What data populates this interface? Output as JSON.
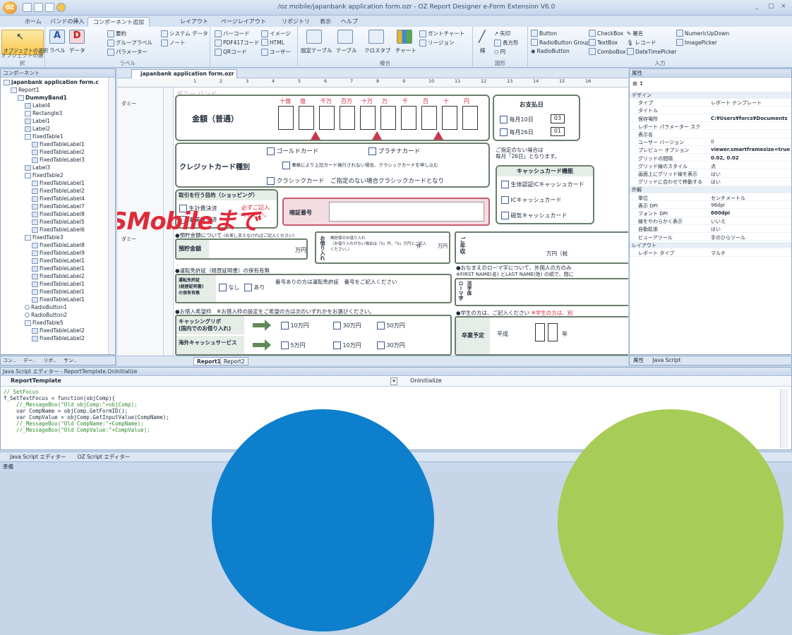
{
  "window": {
    "title": "/oz mobile/japanbank application form.ozr - OZ Report Designer e-Form Extension V6.0",
    "app_logo": "OZ",
    "controls": [
      "_",
      "□",
      "×"
    ]
  },
  "ribbon": {
    "tabs": [
      "ホーム",
      "バンドの挿入",
      "コンポーネント追加",
      "レイアウト",
      "ページレイアウト",
      "リポジトリ",
      "表示",
      "ヘルプ"
    ],
    "active_tab": "コンポーネント追加",
    "groups": {
      "object": {
        "select": "オブジェクトの選択",
        "group_label": "オブジェクトの選択"
      },
      "label": {
        "items": [
          "ラベル",
          "データ",
          "要約",
          "グループラベル",
          "パラメーター",
          "システム データ",
          "ノート",
          "バーコード",
          "PDF417コード",
          "QRコード",
          "イメージ",
          "HTML",
          "ユーザー"
        ],
        "group_label": "ラベル"
      },
      "composite": {
        "items": [
          "固定テーブル",
          "テーブル",
          "クロスタブ",
          "チャート",
          "ガントチャート",
          "リージョン"
        ],
        "group_label": "複合"
      },
      "shapes": {
        "items": [
          "線",
          "矢印",
          "長方形",
          "円"
        ],
        "group_label": "図形"
      },
      "input": {
        "items": [
          "Button",
          "RadioButton Group",
          "RadioButton",
          "CheckBox",
          "TextBox",
          "ComboBox",
          "署名",
          "レコード",
          "DateTimePicker",
          "NumericUpDown",
          "ImagePicker"
        ],
        "group_label": "入力"
      }
    }
  },
  "left_panel": {
    "title": "コンポーネント",
    "tree": [
      {
        "label": "japanbank application form.c",
        "level": 0,
        "bold": true
      },
      {
        "label": "Report1",
        "level": 1
      },
      {
        "label": "DummyBand1",
        "level": 2,
        "bold": true
      },
      {
        "label": "Label4",
        "level": 3
      },
      {
        "label": "Rectangle3",
        "level": 3
      },
      {
        "label": "Label1",
        "level": 3
      },
      {
        "label": "Label2",
        "level": 3
      },
      {
        "label": "FixedTable1",
        "level": 3
      },
      {
        "label": "FixedTableLabel1",
        "level": 4
      },
      {
        "label": "FixedTableLabel2",
        "level": 4
      },
      {
        "label": "FixedTableLabel3",
        "level": 4
      },
      {
        "label": "Label3",
        "level": 3
      },
      {
        "label": "FixedTable2",
        "level": 3
      },
      {
        "label": "FixedTableLabel1",
        "level": 4
      },
      {
        "label": "FixedTableLabel2",
        "level": 4
      },
      {
        "label": "FixedTableLabel4",
        "level": 4
      },
      {
        "label": "FixedTableLabel7",
        "level": 4
      },
      {
        "label": "FixedTableLabel8",
        "level": 4
      },
      {
        "label": "FixedTableLabel5",
        "level": 4
      },
      {
        "label": "FixedTableLabel6",
        "level": 4
      },
      {
        "label": "FixedTable3",
        "level": 3
      },
      {
        "label": "FixedTableLabel8",
        "level": 4
      },
      {
        "label": "FixedTableLabel9",
        "level": 4
      },
      {
        "label": "FixedTableLabel1",
        "level": 4
      },
      {
        "label": "FixedTableLabel1",
        "level": 4
      },
      {
        "label": "FixedTableLabel2",
        "level": 4
      },
      {
        "label": "FixedTableLabel1",
        "level": 4
      },
      {
        "label": "FixedTableLabel1",
        "level": 4
      },
      {
        "label": "FixedTableLabel1",
        "level": 4
      },
      {
        "label": "RadioButton1",
        "level": 3
      },
      {
        "label": "RadioButton2",
        "level": 3
      },
      {
        "label": "FixedTable5",
        "level": 3
      },
      {
        "label": "FixedTableLabel2",
        "level": 4
      },
      {
        "label": "FixedTableLabel2",
        "level": 4
      }
    ],
    "bottom_tabs": [
      "コン..",
      "デー..",
      "リボ..",
      "サン.."
    ]
  },
  "document": {
    "tab": "japanbank application form.ozr",
    "ruler_numbers": [
      "1",
      "2",
      "3",
      "4",
      "5",
      "6",
      "7",
      "8",
      "9",
      "10",
      "11",
      "12",
      "13",
      "14",
      "15",
      "16"
    ],
    "band_labels": [
      "ダミー",
      "ダミー"
    ],
    "sheet_tabs": [
      "Report1",
      "Report2"
    ],
    "form": {
      "dummy_band": "ダミー バンド",
      "amount_title": "金額（普通）",
      "digit_headers": [
        "十億",
        "億",
        "千万",
        "百万",
        "十万",
        "万",
        "千",
        "百",
        "十",
        "円"
      ],
      "payment_day": {
        "title": "お支払日",
        "opt1": "毎月10日",
        "val1": "03",
        "opt2": "毎月26日",
        "val2": "01"
      },
      "note_payment": "ご指定のない場合は\n毎月「26日」となります。",
      "credit_title": "クレジットカード種別",
      "gold": "ゴールドカード",
      "platinum": "プラチナカード",
      "gold_note": "事故により上記カード発行されない場合、クラシックカードを申し込む",
      "classic": "クラシックカード　ご指定のない場合クラシックカードとなり",
      "cash_title": "キャッシュカード機能",
      "cash_opts": [
        "生体認証ICキャッシュカード",
        "ICキャッシュカード",
        "磁気キャッシュカード"
      ],
      "purpose_title": "取引を行う目的（ショッピング）",
      "purpose_opts": [
        "生計費決済",
        "事業費決済"
      ],
      "purpose_required": "必ずご記入\nください。",
      "pin_label": "暗証番号",
      "deposit_title": "●預貯金額について",
      "deposit_note": "(お差し支えなければご記入ください）",
      "deposit_amount": "預貯金額",
      "yen": "万円",
      "borrow_label": "お借り入れ",
      "borrow_note": "無担保のお借り入れ\n（お借り入れがない場合は「0」件、「0」万円とご記入ください。）",
      "count_unit": "件",
      "amount_unit": "万円",
      "income_label": "ご年収",
      "income_unit": "万円（税",
      "license_title": "●運転免許証（経歴証明書）の保有有無",
      "license_label": "運転免許証\n(経歴証明書)\nの保有有無",
      "none": "なし",
      "have": "あり",
      "license_note": "番号ありの方は運転免許証　番号をご記入ください",
      "romaji_note": "●おなまえのローマ字について、外国人の方のみ",
      "romaji_note2": "※FIRST NAME(名) とLAST NAME(姓) の順で、間に",
      "romaji_label": "ローマ字",
      "romaji_label2": "活字体",
      "loan_title": "●お借入希望枠　※お借入枠の設定をご希望の方は次のいずれかをお選びください。",
      "cashing_label": "キャッシングリボ\n(国内でのお借り入れ)",
      "cashing_opts": [
        "10万円",
        "30万円",
        "50万円"
      ],
      "overseas_label": "海外キャッシュサービス",
      "overseas_opts": [
        "5万円",
        "10万円",
        "30万円"
      ],
      "student_note": "●学生の方は、ご記入ください",
      "student_note_red": "※学生の方は、別",
      "grad_label": "卒業予定",
      "era": "平成",
      "year": "年"
    },
    "overlay_text": "SMobileまで"
  },
  "properties": {
    "title": "属性",
    "rows": [
      {
        "k": "デザイン",
        "v": "",
        "cat": true
      },
      {
        "k": "タイプ",
        "v": "レポート テンプレート"
      },
      {
        "k": "タイトル",
        "v": ""
      },
      {
        "k": "保存場所",
        "v": "C:¥Users¥forcs¥Documents"
      },
      {
        "k": "レポート パラメーター スク",
        "v": ""
      },
      {
        "k": "表示名",
        "v": ""
      },
      {
        "k": "ユーザー バージョン",
        "v": "0"
      },
      {
        "k": "プレビュー オプション",
        "v": "viewer.smartframesize=true"
      },
      {
        "k": "グリッドの間隔",
        "v": "0.02, 0.02"
      },
      {
        "k": "グリッド線のスタイル",
        "v": "点"
      },
      {
        "k": "画面上にグリッド線を表示",
        "v": "はい"
      },
      {
        "k": "グリッドに合わせて移動する",
        "v": "はい"
      },
      {
        "k": "外観",
        "v": "",
        "cat": true
      },
      {
        "k": "単位",
        "v": "センチメートル"
      },
      {
        "k": "表示 DPI",
        "v": "96dpi"
      },
      {
        "k": "フォント DPI",
        "v": "600dpi"
      },
      {
        "k": "線をやわらかく表示",
        "v": "いいえ"
      },
      {
        "k": "自動拡張",
        "v": "はい"
      },
      {
        "k": "ビューアツール",
        "v": "手のひらツール"
      },
      {
        "k": "レイアウト",
        "v": "",
        "cat": true
      },
      {
        "k": "レポート タイプ",
        "v": "マルチ"
      }
    ],
    "bottom_tabs": [
      "属性",
      "Java Script"
    ]
  },
  "script": {
    "title": "Java Script エディター - ReportTemplate.OnInitialize",
    "object": "ReportTemplate",
    "event": "OnInitialize",
    "code": [
      {
        "t": "// SetFocus",
        "c": "cm"
      },
      {
        "t": "f_SetTextFocus = function(objComp){",
        "c": ""
      },
      {
        "t": "    //_MessageBox(\"Old objComp:\"+objComp);",
        "c": "cm"
      },
      {
        "t": "    var CompName = objComp.GetFormID();",
        "c": "kw"
      },
      {
        "t": "    var CompValue = objComp.GetInputValue(CompName);",
        "c": "kw"
      },
      {
        "t": "    //_MessageBox(\"Old CompName:\"+CompName);",
        "c": "cm"
      },
      {
        "t": "    //_MessageBox(\"Old CompValue:\"+CompValue);",
        "c": "cm"
      }
    ],
    "tabs": [
      "Java Script エディター",
      "OZ Script エディター"
    ]
  },
  "status": "準備"
}
